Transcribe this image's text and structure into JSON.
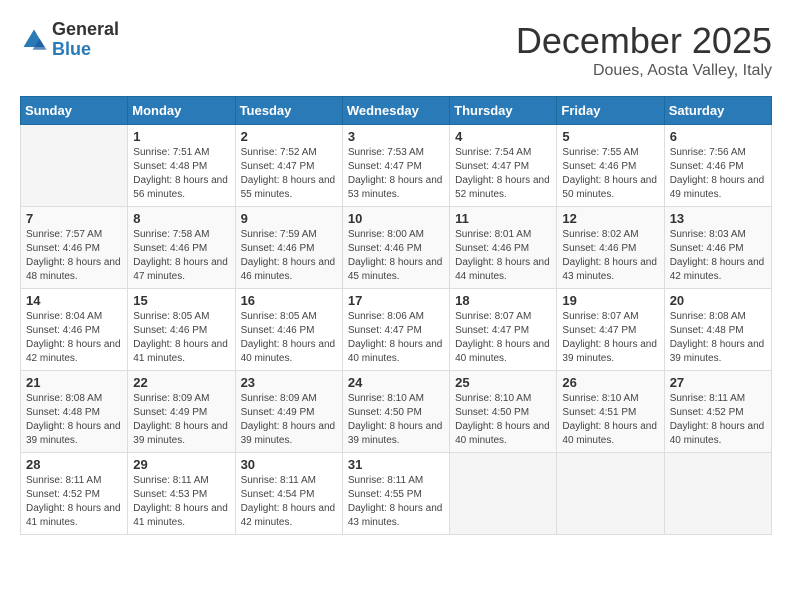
{
  "logo": {
    "general": "General",
    "blue": "Blue"
  },
  "header": {
    "month_title": "December 2025",
    "location": "Doues, Aosta Valley, Italy"
  },
  "days_of_week": [
    "Sunday",
    "Monday",
    "Tuesday",
    "Wednesday",
    "Thursday",
    "Friday",
    "Saturday"
  ],
  "weeks": [
    [
      {
        "day": "",
        "sunrise": "",
        "sunset": "",
        "daylight": ""
      },
      {
        "day": "1",
        "sunrise": "Sunrise: 7:51 AM",
        "sunset": "Sunset: 4:48 PM",
        "daylight": "Daylight: 8 hours and 56 minutes."
      },
      {
        "day": "2",
        "sunrise": "Sunrise: 7:52 AM",
        "sunset": "Sunset: 4:47 PM",
        "daylight": "Daylight: 8 hours and 55 minutes."
      },
      {
        "day": "3",
        "sunrise": "Sunrise: 7:53 AM",
        "sunset": "Sunset: 4:47 PM",
        "daylight": "Daylight: 8 hours and 53 minutes."
      },
      {
        "day": "4",
        "sunrise": "Sunrise: 7:54 AM",
        "sunset": "Sunset: 4:47 PM",
        "daylight": "Daylight: 8 hours and 52 minutes."
      },
      {
        "day": "5",
        "sunrise": "Sunrise: 7:55 AM",
        "sunset": "Sunset: 4:46 PM",
        "daylight": "Daylight: 8 hours and 50 minutes."
      },
      {
        "day": "6",
        "sunrise": "Sunrise: 7:56 AM",
        "sunset": "Sunset: 4:46 PM",
        "daylight": "Daylight: 8 hours and 49 minutes."
      }
    ],
    [
      {
        "day": "7",
        "sunrise": "Sunrise: 7:57 AM",
        "sunset": "Sunset: 4:46 PM",
        "daylight": "Daylight: 8 hours and 48 minutes."
      },
      {
        "day": "8",
        "sunrise": "Sunrise: 7:58 AM",
        "sunset": "Sunset: 4:46 PM",
        "daylight": "Daylight: 8 hours and 47 minutes."
      },
      {
        "day": "9",
        "sunrise": "Sunrise: 7:59 AM",
        "sunset": "Sunset: 4:46 PM",
        "daylight": "Daylight: 8 hours and 46 minutes."
      },
      {
        "day": "10",
        "sunrise": "Sunrise: 8:00 AM",
        "sunset": "Sunset: 4:46 PM",
        "daylight": "Daylight: 8 hours and 45 minutes."
      },
      {
        "day": "11",
        "sunrise": "Sunrise: 8:01 AM",
        "sunset": "Sunset: 4:46 PM",
        "daylight": "Daylight: 8 hours and 44 minutes."
      },
      {
        "day": "12",
        "sunrise": "Sunrise: 8:02 AM",
        "sunset": "Sunset: 4:46 PM",
        "daylight": "Daylight: 8 hours and 43 minutes."
      },
      {
        "day": "13",
        "sunrise": "Sunrise: 8:03 AM",
        "sunset": "Sunset: 4:46 PM",
        "daylight": "Daylight: 8 hours and 42 minutes."
      }
    ],
    [
      {
        "day": "14",
        "sunrise": "Sunrise: 8:04 AM",
        "sunset": "Sunset: 4:46 PM",
        "daylight": "Daylight: 8 hours and 42 minutes."
      },
      {
        "day": "15",
        "sunrise": "Sunrise: 8:05 AM",
        "sunset": "Sunset: 4:46 PM",
        "daylight": "Daylight: 8 hours and 41 minutes."
      },
      {
        "day": "16",
        "sunrise": "Sunrise: 8:05 AM",
        "sunset": "Sunset: 4:46 PM",
        "daylight": "Daylight: 8 hours and 40 minutes."
      },
      {
        "day": "17",
        "sunrise": "Sunrise: 8:06 AM",
        "sunset": "Sunset: 4:47 PM",
        "daylight": "Daylight: 8 hours and 40 minutes."
      },
      {
        "day": "18",
        "sunrise": "Sunrise: 8:07 AM",
        "sunset": "Sunset: 4:47 PM",
        "daylight": "Daylight: 8 hours and 40 minutes."
      },
      {
        "day": "19",
        "sunrise": "Sunrise: 8:07 AM",
        "sunset": "Sunset: 4:47 PM",
        "daylight": "Daylight: 8 hours and 39 minutes."
      },
      {
        "day": "20",
        "sunrise": "Sunrise: 8:08 AM",
        "sunset": "Sunset: 4:48 PM",
        "daylight": "Daylight: 8 hours and 39 minutes."
      }
    ],
    [
      {
        "day": "21",
        "sunrise": "Sunrise: 8:08 AM",
        "sunset": "Sunset: 4:48 PM",
        "daylight": "Daylight: 8 hours and 39 minutes."
      },
      {
        "day": "22",
        "sunrise": "Sunrise: 8:09 AM",
        "sunset": "Sunset: 4:49 PM",
        "daylight": "Daylight: 8 hours and 39 minutes."
      },
      {
        "day": "23",
        "sunrise": "Sunrise: 8:09 AM",
        "sunset": "Sunset: 4:49 PM",
        "daylight": "Daylight: 8 hours and 39 minutes."
      },
      {
        "day": "24",
        "sunrise": "Sunrise: 8:10 AM",
        "sunset": "Sunset: 4:50 PM",
        "daylight": "Daylight: 8 hours and 39 minutes."
      },
      {
        "day": "25",
        "sunrise": "Sunrise: 8:10 AM",
        "sunset": "Sunset: 4:50 PM",
        "daylight": "Daylight: 8 hours and 40 minutes."
      },
      {
        "day": "26",
        "sunrise": "Sunrise: 8:10 AM",
        "sunset": "Sunset: 4:51 PM",
        "daylight": "Daylight: 8 hours and 40 minutes."
      },
      {
        "day": "27",
        "sunrise": "Sunrise: 8:11 AM",
        "sunset": "Sunset: 4:52 PM",
        "daylight": "Daylight: 8 hours and 40 minutes."
      }
    ],
    [
      {
        "day": "28",
        "sunrise": "Sunrise: 8:11 AM",
        "sunset": "Sunset: 4:52 PM",
        "daylight": "Daylight: 8 hours and 41 minutes."
      },
      {
        "day": "29",
        "sunrise": "Sunrise: 8:11 AM",
        "sunset": "Sunset: 4:53 PM",
        "daylight": "Daylight: 8 hours and 41 minutes."
      },
      {
        "day": "30",
        "sunrise": "Sunrise: 8:11 AM",
        "sunset": "Sunset: 4:54 PM",
        "daylight": "Daylight: 8 hours and 42 minutes."
      },
      {
        "day": "31",
        "sunrise": "Sunrise: 8:11 AM",
        "sunset": "Sunset: 4:55 PM",
        "daylight": "Daylight: 8 hours and 43 minutes."
      },
      {
        "day": "",
        "sunrise": "",
        "sunset": "",
        "daylight": ""
      },
      {
        "day": "",
        "sunrise": "",
        "sunset": "",
        "daylight": ""
      },
      {
        "day": "",
        "sunrise": "",
        "sunset": "",
        "daylight": ""
      }
    ]
  ]
}
